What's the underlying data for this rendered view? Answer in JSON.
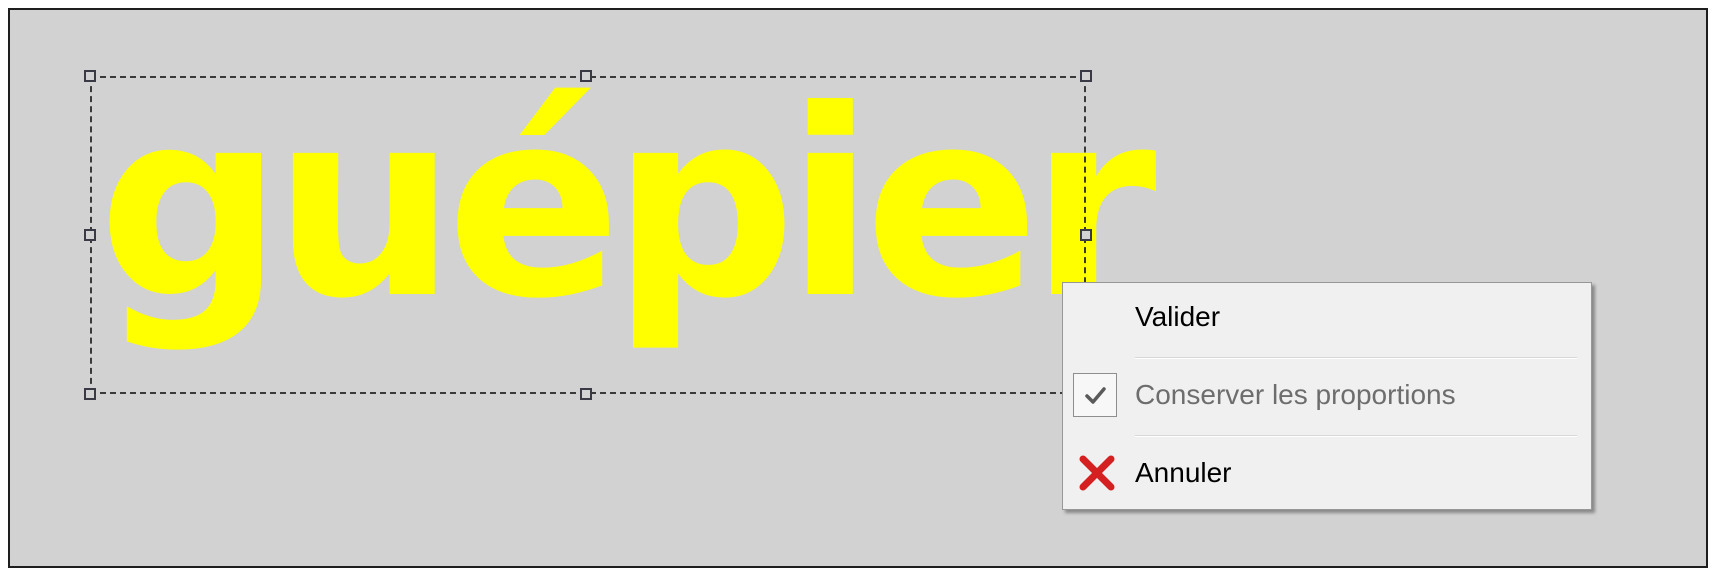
{
  "canvas": {
    "text": "guépier",
    "text_color": "#ffff00",
    "background_color": "#d2d2d2"
  },
  "context_menu": {
    "items": [
      {
        "label": "Valider",
        "enabled": true
      },
      {
        "label": "Conserver les proportions",
        "enabled": false,
        "checked": true,
        "icon": "checkmark-icon"
      },
      {
        "label": "Annuler",
        "enabled": true,
        "icon": "red-x-cancel-icon"
      }
    ]
  },
  "colors": {
    "cancel_icon": "#d42020",
    "selection_border": "#3a3a3a"
  }
}
